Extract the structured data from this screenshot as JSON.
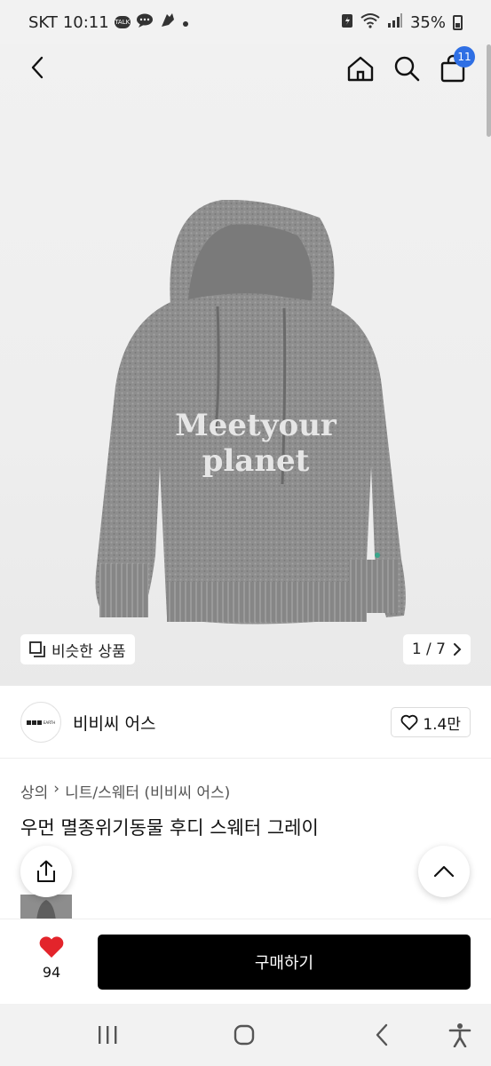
{
  "status_bar": {
    "carrier": "SKT",
    "time": "10:11",
    "talk_badge": "TALK",
    "battery": "35%"
  },
  "top_nav": {
    "cart_count": "11",
    "icons": [
      "back-chevron-icon",
      "home-icon",
      "search-icon",
      "shopping-bag-icon"
    ]
  },
  "product_image": {
    "print_line1": "Meetyour",
    "print_line2": "planet",
    "similar_button": "비슷한 상품",
    "page_counter": "1 / 7"
  },
  "brand": {
    "logo_text": "EARTH",
    "name": "비비씨 어스",
    "likes": "1.4만"
  },
  "category": {
    "main": "상의",
    "sub": "니트/스웨터 (비비씨 어스)"
  },
  "product": {
    "title": "우먼 멸종위기동물 후디 스웨터 그레이"
  },
  "bottom_bar": {
    "wish_count": "94",
    "buy_label": "구매하기"
  },
  "colors": {
    "accent_blue": "#2f6fe4",
    "heart_red": "#e3242b",
    "buy_black": "#000000"
  }
}
